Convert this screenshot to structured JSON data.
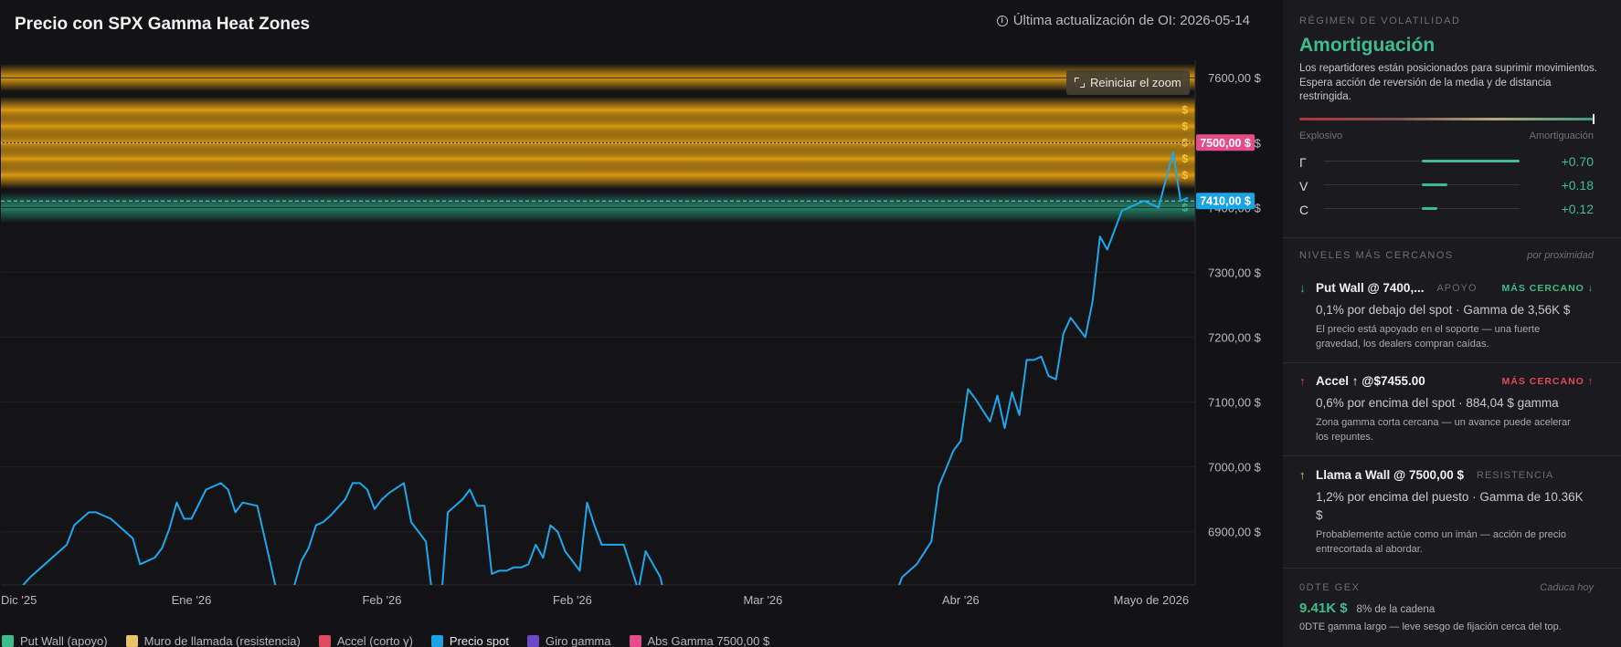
{
  "chart": {
    "title": "Precio con SPX Gamma Heat Zones",
    "oi_update": "Última actualización de OI: 2026-05-14",
    "reset_zoom": "Reiniciar el zoom",
    "price_badge": "7500,00 $",
    "spot_badge": "7410,00 $",
    "dollar_marker": "$",
    "colors": {
      "spot": "#1ea7ec",
      "call_zone": "#f1a80f",
      "put_zone": "#2aa67e",
      "badge_pink": "#e64b8c",
      "badge_blue": "#1aa3e5"
    }
  },
  "legend": [
    {
      "label": "Put Wall (apoyo)",
      "color": "#3dbd8e"
    },
    {
      "label": "Muro de llamada (resistencia)",
      "color": "#e8c36a"
    },
    {
      "label": "Accel (corto γ)",
      "color": "#e0485c"
    },
    {
      "label": "Precio spot",
      "color": "#1aa3e5"
    },
    {
      "label": "Giro gamma",
      "color": "#6a48c9"
    },
    {
      "label": "Abs Gamma 7500,00 $",
      "color": "#e64b8c"
    }
  ],
  "chart_data": {
    "type": "line",
    "title": "Precio con SPX Gamma Heat Zones",
    "xlabel": "",
    "ylabel": "",
    "x_ticks": [
      "Dic '25",
      "Ene '26",
      "Feb '26",
      "Feb '26",
      "Mar '26",
      "Abr '26",
      "Mayo de 2026"
    ],
    "y_ticks": [
      "7600,00 $",
      "7500,00 $",
      "7400,00 $",
      "7300,00 $",
      "7200,00 $",
      "7100,00 $",
      "7000,00 $",
      "6900,00 $"
    ],
    "ylim": [
      6818,
      7627
    ],
    "xlim": [
      0,
      163
    ],
    "zones": [
      {
        "type": "call_wall",
        "price": 7600
      },
      {
        "type": "call_wall",
        "price": 7550
      },
      {
        "type": "call_wall",
        "price": 7525
      },
      {
        "type": "call_wall",
        "price": 7500
      },
      {
        "type": "call_wall",
        "price": 7475
      },
      {
        "type": "call_wall",
        "price": 7450
      },
      {
        "type": "put_wall",
        "price": 7400
      }
    ],
    "spot_price": 7410,
    "abs_gamma": 7500,
    "series": [
      {
        "name": "Precio spot",
        "x": [
          0,
          4,
          8,
          9,
          10,
          12,
          13,
          15,
          16,
          17,
          18,
          19,
          20,
          21,
          22,
          23,
          24,
          25,
          26,
          28,
          29,
          30,
          31,
          32,
          33,
          35,
          36,
          38,
          39,
          40,
          41,
          42,
          43,
          44,
          45,
          47,
          48,
          49,
          50,
          51,
          52,
          53,
          55,
          56,
          58,
          59,
          60,
          61,
          63,
          64,
          65,
          66,
          67,
          68,
          69,
          70,
          71,
          72,
          73,
          74,
          75,
          76,
          77,
          79,
          80,
          81,
          82,
          84,
          85,
          87,
          88,
          90,
          91,
          92,
          93,
          95,
          96,
          97,
          98,
          121,
          122,
          123,
          124,
          125,
          127,
          128,
          130,
          131,
          132,
          133,
          135,
          136,
          137,
          138,
          139,
          140,
          141,
          142,
          143,
          144,
          145,
          146,
          148,
          149,
          150,
          151,
          152,
          153,
          154,
          156,
          157,
          158,
          160,
          161,
          162
        ],
        "y": [
          6780,
          6830,
          6870,
          6880,
          6910,
          6930,
          6930,
          6920,
          6910,
          6900,
          6890,
          6850,
          6855,
          6860,
          6875,
          6905,
          6945,
          6920,
          6920,
          6965,
          6970,
          6975,
          6965,
          6930,
          6945,
          6940,
          6890,
          6790,
          6770,
          6815,
          6855,
          6875,
          6910,
          6915,
          6925,
          6950,
          6975,
          6975,
          6965,
          6935,
          6950,
          6960,
          6975,
          6915,
          6885,
          6790,
          6780,
          6930,
          6950,
          6965,
          6940,
          6940,
          6835,
          6840,
          6840,
          6845,
          6845,
          6850,
          6880,
          6860,
          6910,
          6900,
          6870,
          6840,
          6945,
          6910,
          6880,
          6880,
          6880,
          6810,
          6870,
          6830,
          6780,
          6780,
          6790,
          6760,
          6770,
          6780,
          6780,
          6780,
          6800,
          6830,
          6840,
          6850,
          6885,
          6970,
          7025,
          7040,
          7120,
          7105,
          7070,
          7110,
          7060,
          7115,
          7080,
          7165,
          7165,
          7170,
          7140,
          7135,
          7205,
          7230,
          7200,
          7255,
          7355,
          7335,
          7365,
          7395,
          7400,
          7410,
          7405,
          7400,
          7485,
          7410,
          7415
        ]
      }
    ]
  },
  "sidebar": {
    "regime": {
      "label": "RÉGIMEN DE VOLATILIDAD",
      "name": "Amortiguación",
      "description": "Los repartidores están posicionados para suprimir movimientos. Espera acción de reversión de la media y de distancia restringida.",
      "left_end": "Explosivo",
      "right_end": "Amortiguación",
      "marker_position": 1.0
    },
    "greeks": [
      {
        "symbol": "Γ",
        "value": "+0.70",
        "fill_start": 0.5,
        "fill_end": 1.0
      },
      {
        "symbol": "V",
        "value": "+0.18",
        "fill_start": 0.5,
        "fill_end": 0.63
      },
      {
        "symbol": "C",
        "value": "+0.12",
        "fill_start": 0.5,
        "fill_end": 0.58
      }
    ],
    "nearest": {
      "label": "NIVELES MÁS CERCANOS",
      "sort": "por proximidad",
      "levels": [
        {
          "arrow": "↓",
          "arrow_color": "#3dbd8e",
          "title": "Put Wall @ 7400,...",
          "tag": "APOYO",
          "nearest": "MÁS CERCANO ↓",
          "nearest_color": "#3dbd8e",
          "stat": "0,1% por debajo del spot · Gamma de 3,56K $",
          "note": "El precio está apoyado en el soporte — una fuerte gravedad, los dealers compran caídas."
        },
        {
          "arrow": "↑",
          "arrow_color": "#e0485c",
          "title": "Accel ↑ @$7455.00",
          "tag": "",
          "nearest": "MÁS CERCANO ↑",
          "nearest_color": "#e0485c",
          "stat": "0,6% por encima del spot · 884,04 $ gamma",
          "note": "Zona gamma corta cercana — un avance puede acelerar los repuntes."
        },
        {
          "arrow": "↑",
          "arrow_color": "#e8c36a",
          "title": "Llama a Wall @ 7500,00 $",
          "tag": "RESISTENCIA",
          "nearest": "",
          "nearest_color": "#e8c36a",
          "stat": "1,2% por encima del puesto · Gamma de 10.36K $",
          "note": "Probablemente actúe como un imán — acción de precio entrecortada al abordar."
        }
      ]
    },
    "gex": {
      "label": "0DTE GEX",
      "expiry": "Caduca hoy",
      "value": "9.41K $",
      "pct": "8% de la cadena",
      "note": "0DTE gamma largo — leve sesgo de fijación cerca del top."
    }
  }
}
